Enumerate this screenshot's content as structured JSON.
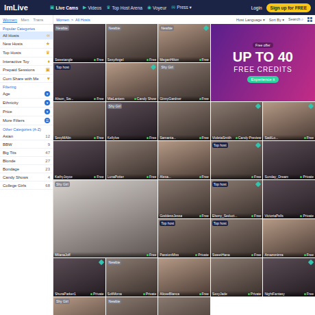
{
  "header": {
    "logo": "ImLive",
    "nav": [
      {
        "label": "Live Cams",
        "icon": "▣",
        "selected": true
      },
      {
        "label": "Videos",
        "icon": "▶",
        "selected": false
      },
      {
        "label": "Top Host Arena",
        "icon": "♛",
        "selected": false
      },
      {
        "label": "Voyeur",
        "icon": "◉",
        "selected": false
      },
      {
        "label": "Press ▾",
        "icon": "✉",
        "selected": false
      }
    ],
    "login": "Login",
    "signup": "Sign up for FREE"
  },
  "sidebar": {
    "tabs": [
      {
        "label": "Women",
        "selected": true
      },
      {
        "label": "Men",
        "selected": false
      },
      {
        "label": "Trans",
        "selected": false
      }
    ],
    "popular_title": "Popular Categories",
    "popular": [
      {
        "label": "All Hosts",
        "icon": "∞",
        "selected": true
      },
      {
        "label": "New Hosts",
        "icon": "★",
        "selected": false
      },
      {
        "label": "Top Hosts",
        "icon": "♛",
        "selected": false
      },
      {
        "label": "Interactive Toy",
        "icon": "♦",
        "selected": false
      },
      {
        "label": "Prepaid Sessions",
        "icon": "▣",
        "selected": false
      },
      {
        "label": "Cum Share with Me",
        "icon": "♥",
        "selected": false
      }
    ],
    "filter_title": "Filtering",
    "filters": [
      {
        "label": "Age",
        "icon": "▾"
      },
      {
        "label": "Ethnicity",
        "icon": "▾"
      },
      {
        "label": "Price",
        "icon": "▾"
      },
      {
        "label": "More Filters",
        "icon": "☰"
      }
    ],
    "other_title": "Other Categories (A-Z)",
    "other": [
      {
        "label": "Asian",
        "count": "12"
      },
      {
        "label": "BBW",
        "count": "9"
      },
      {
        "label": "Big Tits",
        "count": "47"
      },
      {
        "label": "Blonde",
        "count": "27"
      },
      {
        "label": "Bondage",
        "count": "23"
      },
      {
        "label": "Candy Shows",
        "count": "4"
      },
      {
        "label": "College Girls",
        "count": "68"
      }
    ]
  },
  "toolbar": {
    "breadcrumb": [
      "Women",
      ">",
      "All Hosts"
    ],
    "language": "Host Language ▾",
    "sort": "Sort By ▾",
    "search": "Search",
    "search_icon": "⌕"
  },
  "promo": {
    "kicker": "Free offer",
    "headline": "UP TO 40",
    "sub": "FREE CREDITS",
    "button": "Experience it"
  },
  "cards": [
    {
      "kind": "tile",
      "name": "Sweetangle",
      "badge": "Newbie",
      "status": "Free",
      "toy": false
    },
    {
      "kind": "tile",
      "name": "SexyAngel",
      "badge": "Newbie",
      "status": "Free",
      "toy": false
    },
    {
      "kind": "tile",
      "name": "MeganHilton",
      "badge": "Newbie",
      "status": "Free",
      "toy": true
    },
    {
      "kind": "promo",
      "name": "",
      "badge": "",
      "status": "",
      "toy": false
    },
    {
      "kind": "tile",
      "name": "Alison_Sw...",
      "badge": "Top host",
      "status": "Free",
      "toy": false
    },
    {
      "kind": "tile",
      "name": "MiaLantern",
      "badge": "",
      "status": "Candy Show",
      "toy": true
    },
    {
      "kind": "tile",
      "name": "GinnyGardner",
      "badge": "Shy Girl",
      "status": "Free",
      "toy": false
    },
    {
      "kind": "tile",
      "name": "SexyMAlin",
      "badge": "",
      "status": "Free",
      "toy": false
    },
    {
      "kind": "tile",
      "name": "KellyIve",
      "badge": "Shy Girl",
      "status": "Free",
      "toy": false
    },
    {
      "kind": "tile",
      "name": "Samanta...",
      "badge": "",
      "status": "Free",
      "toy": false
    },
    {
      "kind": "tile",
      "name": "VioletaSmith",
      "badge": "",
      "status": "Candy Preview",
      "toy": true
    },
    {
      "kind": "tile",
      "name": "SadiLo...",
      "badge": "",
      "status": "Free",
      "toy": true
    },
    {
      "kind": "tile",
      "name": "KathyJoyce",
      "badge": "",
      "status": "Free",
      "toy": false
    },
    {
      "kind": "tile",
      "name": "LunaPotter",
      "badge": "",
      "status": "Free",
      "toy": false
    },
    {
      "kind": "tile",
      "name": "Alexa...",
      "badge": "",
      "status": "Free",
      "toy": false
    },
    {
      "kind": "tile",
      "name": "",
      "badge": "Top host",
      "status": "Free",
      "toy": true
    },
    {
      "kind": "tile",
      "name": "Sunday_Dream",
      "badge": "",
      "status": "Private",
      "toy": false
    },
    {
      "kind": "large",
      "name": "MilanaJoff",
      "badge": "Shy Girl",
      "status": "Free",
      "toy": false
    },
    {
      "kind": "tile",
      "name": "GoddessJessa",
      "badge": "",
      "status": "Free",
      "toy": false
    },
    {
      "kind": "tile",
      "name": "Ebony_Seduct...",
      "badge": "Top host",
      "status": "Free",
      "toy": true
    },
    {
      "kind": "tile",
      "name": "VictoriaPells",
      "badge": "",
      "status": "Private",
      "toy": false
    },
    {
      "kind": "tile",
      "name": "PassionMiss",
      "badge": "Top host",
      "status": "Private",
      "toy": false
    },
    {
      "kind": "tile",
      "name": "SweetHana",
      "badge": "Top host",
      "status": "Free",
      "toy": false
    },
    {
      "kind": "tile",
      "name": "Amazonizza",
      "badge": "",
      "status": "Free",
      "toy": false
    },
    {
      "kind": "tile",
      "name": "ShuraParker1",
      "badge": "",
      "status": "Private",
      "toy": true
    },
    {
      "kind": "tile",
      "name": "SofiMona",
      "badge": "Newbie",
      "status": "Private",
      "toy": false
    },
    {
      "kind": "tile",
      "name": "AliceeBlanca",
      "badge": "",
      "status": "Free",
      "toy": false
    },
    {
      "kind": "tile",
      "name": "SexyJade",
      "badge": "",
      "status": "Private",
      "toy": false
    },
    {
      "kind": "tile",
      "name": "NightFantasy",
      "badge": "",
      "status": "Free",
      "toy": true
    },
    {
      "kind": "tile",
      "name": "",
      "badge": "Shy Girl",
      "status": "",
      "toy": false
    },
    {
      "kind": "tile",
      "name": "",
      "badge": "Newbie",
      "status": "",
      "toy": false
    },
    {
      "kind": "tile",
      "name": "",
      "badge": "",
      "status": "",
      "toy": false
    }
  ]
}
